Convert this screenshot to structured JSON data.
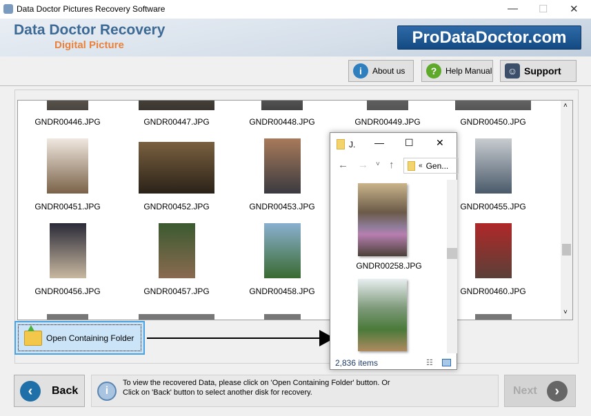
{
  "window": {
    "title": "Data Doctor Pictures Recovery Software",
    "minimize": "—",
    "maximize": "☐",
    "close": "✕"
  },
  "banner": {
    "line1": "Data Doctor Recovery",
    "line2": "Digital Picture",
    "logo": "ProDataDoctor.com"
  },
  "toolbar": {
    "about": "About us",
    "help": "Help Manual",
    "support": "Support"
  },
  "files": [
    [
      "GNDR00446.JPG",
      "GNDR00447.JPG",
      "GNDR00448.JPG",
      "GNDR00449.JPG",
      "GNDR00450.JPG"
    ],
    [
      "GNDR00451.JPG",
      "GNDR00452.JPG",
      "GNDR00453.JPG",
      "",
      "GNDR00455.JPG"
    ],
    [
      "GNDR00456.JPG",
      "GNDR00457.JPG",
      "GNDR00458.JPG",
      "",
      "GNDR00460.JPG"
    ]
  ],
  "open_folder_button": "Open Containing Folder",
  "explorer": {
    "title": "J.",
    "path_prefix": "«",
    "path": "Gen...",
    "file": "GNDR00258.JPG",
    "status": "2,836 items"
  },
  "footer": {
    "back": "Back",
    "next": "Next",
    "message_line1": "To view the recovered Data, please click on 'Open Containing Folder' button. Or",
    "message_line2": "Click on 'Back' button to select another disk for recovery."
  }
}
